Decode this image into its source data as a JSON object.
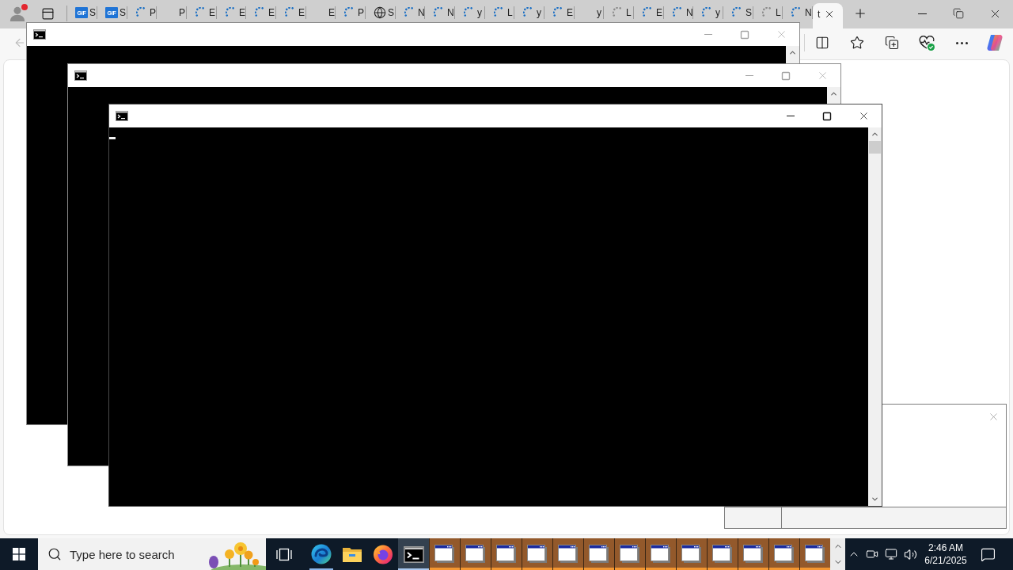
{
  "browser": {
    "profile": {
      "notification": true
    },
    "tabs": [
      {
        "kind": "badge",
        "badge": "GIF",
        "label": "S",
        "selected": false
      },
      {
        "kind": "badge",
        "badge": "GIF",
        "label": "S",
        "selected": false
      },
      {
        "kind": "loading",
        "label": "P",
        "selected": false
      },
      {
        "kind": "blank",
        "label": "P",
        "selected": false
      },
      {
        "kind": "loading",
        "label": "E",
        "selected": false
      },
      {
        "kind": "loading",
        "label": "E",
        "selected": false
      },
      {
        "kind": "loading",
        "label": "E",
        "selected": false
      },
      {
        "kind": "loading",
        "label": "E",
        "selected": false
      },
      {
        "kind": "blank",
        "label": "E",
        "selected": false
      },
      {
        "kind": "loading",
        "label": "P",
        "selected": false
      },
      {
        "kind": "globe",
        "label": "S",
        "selected": false
      },
      {
        "kind": "loading",
        "label": "N",
        "selected": false
      },
      {
        "kind": "loading",
        "label": "N",
        "selected": false
      },
      {
        "kind": "loading",
        "label": "y",
        "selected": false
      },
      {
        "kind": "loading",
        "label": "L",
        "selected": false
      },
      {
        "kind": "loading",
        "label": "y",
        "selected": false
      },
      {
        "kind": "loading",
        "label": "E",
        "selected": false
      },
      {
        "kind": "blank",
        "label": "y",
        "selected": false
      },
      {
        "kind": "waiting",
        "label": "L",
        "selected": false
      },
      {
        "kind": "loading",
        "label": "E",
        "selected": false
      },
      {
        "kind": "loading",
        "label": "N",
        "selected": false
      },
      {
        "kind": "loading",
        "label": "y",
        "selected": false
      },
      {
        "kind": "loading",
        "label": "S",
        "selected": false
      },
      {
        "kind": "waiting",
        "label": "L",
        "selected": false
      },
      {
        "kind": "loading",
        "label": "N",
        "selected": false
      },
      {
        "kind": "blank",
        "label": "t",
        "selected": true
      }
    ],
    "toolbar": {
      "back": {
        "disabled": true
      }
    }
  },
  "console_windows": [
    {
      "active": false
    },
    {
      "active": false
    },
    {
      "active": true
    }
  ],
  "taskbar": {
    "search": {
      "placeholder": "Type here to search"
    },
    "buttons": [
      {
        "kind": "task_view",
        "running": false,
        "selected": false,
        "flashing": false
      },
      {
        "kind": "edge",
        "running": true,
        "selected": false,
        "flashing": false
      },
      {
        "kind": "explorer",
        "running": false,
        "selected": false,
        "flashing": false
      },
      {
        "kind": "firefox",
        "running": false,
        "selected": false,
        "flashing": false
      },
      {
        "kind": "console",
        "running": true,
        "selected": true,
        "flashing": false
      },
      {
        "kind": "window",
        "running": true,
        "selected": false,
        "flashing": true
      },
      {
        "kind": "window",
        "running": true,
        "selected": false,
        "flashing": true
      },
      {
        "kind": "window",
        "running": true,
        "selected": false,
        "flashing": true
      },
      {
        "kind": "window",
        "running": true,
        "selected": false,
        "flashing": true
      },
      {
        "kind": "window",
        "running": true,
        "selected": false,
        "flashing": true
      },
      {
        "kind": "window",
        "running": true,
        "selected": false,
        "flashing": true
      },
      {
        "kind": "window",
        "running": true,
        "selected": false,
        "flashing": true
      },
      {
        "kind": "window",
        "running": true,
        "selected": false,
        "flashing": true
      },
      {
        "kind": "window",
        "running": true,
        "selected": false,
        "flashing": true
      },
      {
        "kind": "window",
        "running": true,
        "selected": false,
        "flashing": true
      },
      {
        "kind": "window",
        "running": true,
        "selected": false,
        "flashing": true
      },
      {
        "kind": "window",
        "running": true,
        "selected": false,
        "flashing": true
      },
      {
        "kind": "window",
        "running": true,
        "selected": false,
        "flashing": true
      }
    ],
    "clock": {
      "time": "2:46 AM",
      "date": "6/21/2025"
    }
  }
}
